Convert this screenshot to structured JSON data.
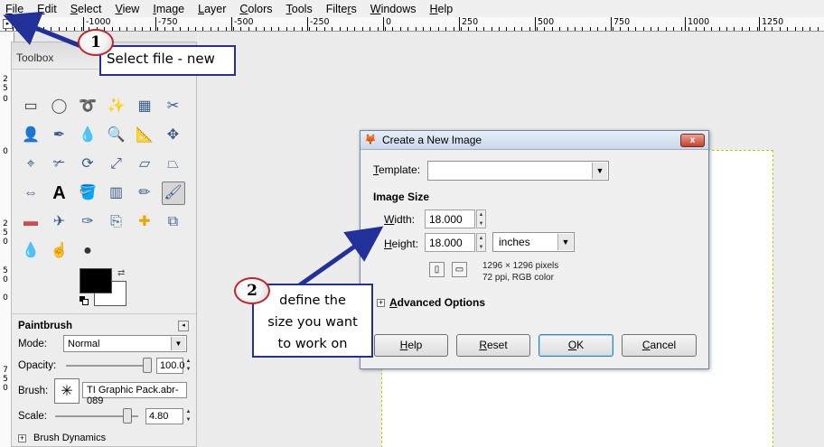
{
  "menu": {
    "file": {
      "u": "F",
      "rest": "ile"
    },
    "edit": {
      "u": "E",
      "rest": "dit"
    },
    "select": {
      "u": "S",
      "rest": "elect"
    },
    "view": {
      "u": "V",
      "rest": "iew"
    },
    "image": {
      "u": "I",
      "rest": "mage"
    },
    "layer": {
      "u": "L",
      "rest": "ayer"
    },
    "colors": {
      "u": "C",
      "rest": "olors"
    },
    "tools": {
      "u": "T",
      "rest": "ools"
    },
    "filters": {
      "pre": "Filte",
      "u": "r",
      "rest": "s"
    },
    "windows": {
      "u": "W",
      "rest": "indows"
    },
    "help": {
      "u": "H",
      "rest": "elp"
    }
  },
  "ruler": {
    "top_labels": [
      "-250",
      "-1000",
      "-750",
      "-500",
      "-250",
      "0",
      "250",
      "500",
      "750",
      "1000",
      "1250"
    ],
    "left_labels": [
      "2",
      "5",
      "0",
      "0",
      "2",
      "5",
      "0",
      "5",
      "0",
      "0",
      "7",
      "5",
      "0"
    ]
  },
  "toolbox": {
    "title": "Toolbox",
    "tool_options": {
      "title": "Paintbrush",
      "mode_label": "Mode:",
      "mode_value": "Normal",
      "opacity_label": "Opacity:",
      "opacity_value": "100.0",
      "opacity_level_percent": 100,
      "brush_label": "Brush:",
      "brush_value": "TI Graphic Pack.abr-089",
      "scale_label": "Scale:",
      "scale_value": "4.80",
      "brush_dynamics_label": "Brush Dynamics"
    },
    "icons": [
      "rect-select-icon",
      "ellipse-select-icon",
      "free-select-icon",
      "fuzzy-select-icon",
      "select-by-color-icon",
      "scissors-select-icon",
      "foreground-select-icon",
      "paths-icon",
      "color-picker-icon",
      "zoom-icon",
      "measure-icon",
      "move-icon",
      "alignment-icon",
      "crop-icon",
      "rotate-icon",
      "scale-icon",
      "shear-icon",
      "perspective-icon",
      "flip-icon",
      "text-icon",
      "bucket-fill-icon",
      "blend-icon",
      "pencil-icon",
      "paintbrush-icon",
      "eraser-icon",
      "airbrush-icon",
      "ink-icon",
      "clone-icon",
      "heal-icon",
      "perspective-clone-icon",
      "blur-icon",
      "smudge-icon",
      "dodge-burn-icon"
    ]
  },
  "dialog": {
    "title": "Create a New Image",
    "close_label": "x",
    "template_label": {
      "u": "T",
      "rest": "emplate:"
    },
    "template_value": "",
    "image_size_label": "Image Size",
    "width_label": {
      "u": "W",
      "rest": "idth:"
    },
    "width_value": "18.000",
    "height_label": {
      "u": "H",
      "rest": "eight:"
    },
    "height_value": "18.000",
    "unit_value": "inches",
    "pixels_info": "1296 × 1296 pixels",
    "resolution_info": "72 ppi, RGB color",
    "advanced_label": {
      "u": "A",
      "rest": "dvanced Options"
    },
    "buttons": {
      "help": {
        "u": "H",
        "rest": "elp"
      },
      "reset": {
        "u": "R",
        "rest": "eset"
      },
      "ok": {
        "u": "O",
        "rest": "K"
      },
      "cancel": {
        "u": "C",
        "rest": "ancel"
      }
    }
  },
  "annotations": {
    "badge_1": "1",
    "callout_1": "Select file - new",
    "badge_2": "2",
    "callout_2_lines": [
      "define the",
      "size you want",
      "to work on"
    ]
  },
  "colors": {
    "callout_border": "#22309a",
    "arrow": "#22309a",
    "badge_ring": "#c0262b"
  }
}
